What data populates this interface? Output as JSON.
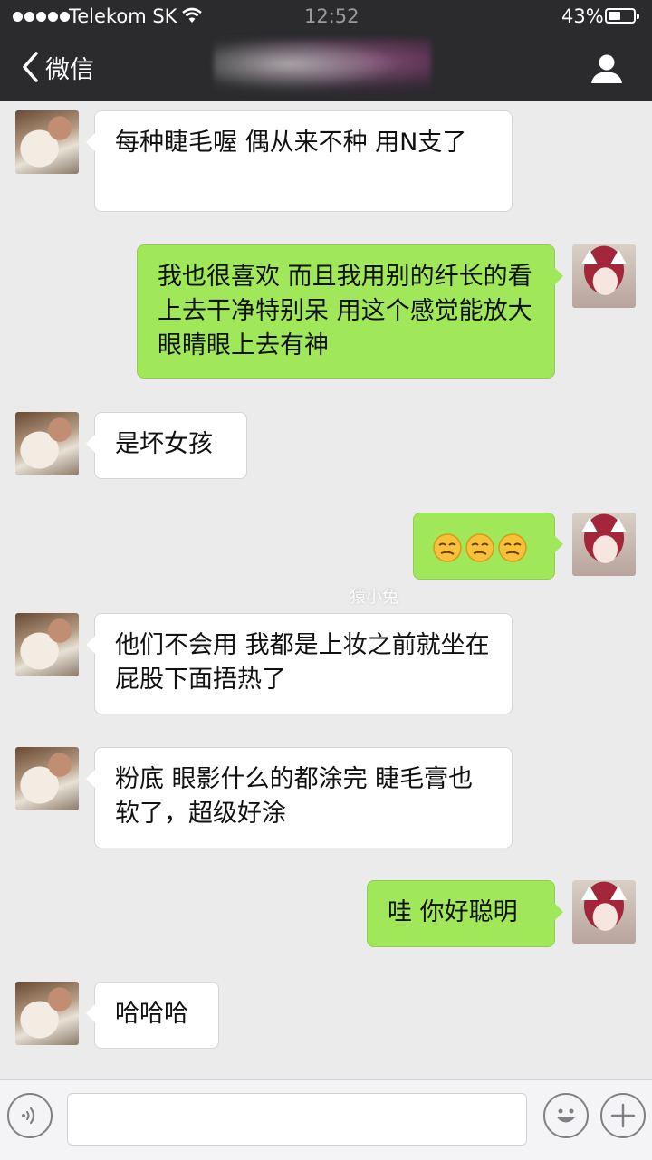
{
  "status_bar": {
    "carrier": "Telekom SK",
    "time": "12:52",
    "battery": "43%"
  },
  "nav": {
    "back_label": "微信"
  },
  "messages": [
    {
      "side": "left",
      "text": "每种睫毛喔 偶从来不种 用N支了"
    },
    {
      "side": "right",
      "text": "我也很喜欢 而且我用别的纤长的看上去干净特别呆 用这个感觉能放大眼睛眼上去有神"
    },
    {
      "side": "left",
      "text": "是坏女孩"
    },
    {
      "side": "right",
      "emoji": [
        "smirk-face-icon",
        "smirk-face-icon",
        "smirk-face-icon"
      ]
    },
    {
      "side": "left",
      "text": "他们不会用 我都是上妆之前就坐在屁股下面捂热了"
    },
    {
      "side": "left",
      "text": "粉底 眼影什么的都涂完 睫毛膏也软了，超级好涂"
    },
    {
      "side": "right",
      "text": "哇 你好聪明"
    },
    {
      "side": "left",
      "text": "哈哈哈"
    }
  ],
  "watermark": "猿小兔",
  "input_bar": {
    "value": ""
  },
  "colors": {
    "nav_bg": "#2b2b2e",
    "chat_bg": "#ebebeb",
    "sent_bubble": "#a0e75a",
    "received_bubble": "#ffffff"
  }
}
